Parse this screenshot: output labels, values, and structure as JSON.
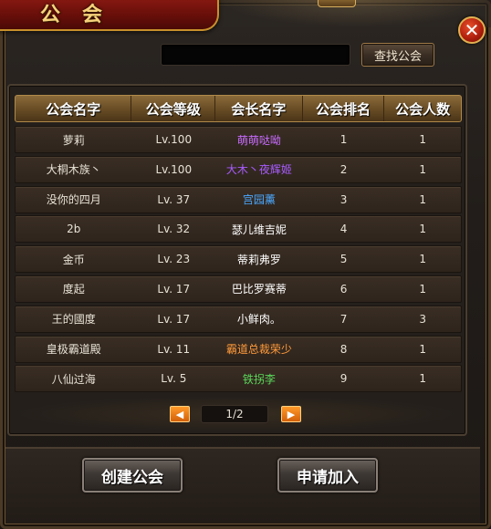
{
  "window": {
    "title": "公会",
    "close_label": "✕"
  },
  "search": {
    "value": "",
    "placeholder": "",
    "button_label": "查找公会"
  },
  "table": {
    "headers": [
      "公会名字",
      "公会等级",
      "会长名字",
      "公会排名",
      "公会人数"
    ],
    "rows": [
      {
        "name": "萝莉",
        "level": "Lv.100",
        "leader": "萌萌哒呦",
        "leader_color": "#c86cff",
        "rank": "1",
        "members": "1"
      },
      {
        "name": "大桐木族丶",
        "level": "Lv.100",
        "leader": "大木丶夜辉姬",
        "leader_color": "#a85cff",
        "rank": "2",
        "members": "1"
      },
      {
        "name": "没你的四月",
        "level": "Lv. 37",
        "leader": "宫园薰",
        "leader_color": "#4aa8ff",
        "rank": "3",
        "members": "1"
      },
      {
        "name": "2b",
        "level": "Lv. 32",
        "leader": "瑟儿维吉妮",
        "leader_color": "#ffffff",
        "rank": "4",
        "members": "1"
      },
      {
        "name": "金币",
        "level": "Lv. 23",
        "leader": "蒂莉弗罗",
        "leader_color": "#ffffff",
        "rank": "5",
        "members": "1"
      },
      {
        "name": "度起",
        "level": "Lv. 17",
        "leader": "巴比罗赛蒂",
        "leader_color": "#ffffff",
        "rank": "6",
        "members": "1"
      },
      {
        "name": "王的國度",
        "level": "Lv. 17",
        "leader": "小鲜肉。",
        "leader_color": "#ffffff",
        "rank": "7",
        "members": "3"
      },
      {
        "name": "皇极霸道殿",
        "level": "Lv. 11",
        "leader": "霸道总裁荣少",
        "leader_color": "#ff9a3a",
        "rank": "8",
        "members": "1"
      },
      {
        "name": "八仙过海",
        "level": "Lv. 5",
        "leader": "铁拐李",
        "leader_color": "#5ad85a",
        "rank": "9",
        "members": "1"
      }
    ]
  },
  "pagination": {
    "prev_label": "◀",
    "next_label": "▶",
    "indicator": "1/2"
  },
  "actions": {
    "create_label": "创建公会",
    "apply_label": "申请加入"
  }
}
